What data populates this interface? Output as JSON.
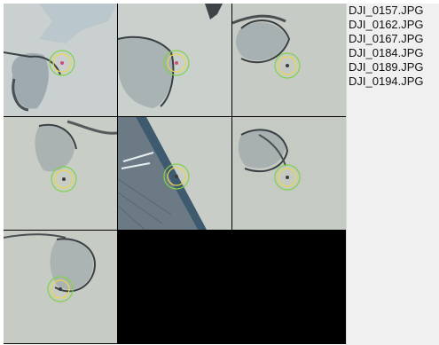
{
  "files": [
    "DJI_0157.JPG",
    "DJI_0162.JPG",
    "DJI_0167.JPG",
    "DJI_0184.JPG",
    "DJI_0189.JPG",
    "DJI_0194.JPG"
  ],
  "thumbnails": [
    {
      "scene": "floe-left",
      "bg": "#b9c6cb"
    },
    {
      "scene": "floe-center",
      "bg": "#c9cfcc"
    },
    {
      "scene": "floe-right",
      "bg": "#c6cac5"
    },
    {
      "scene": "floe-top",
      "bg": "#c7ccc5"
    },
    {
      "scene": "ship-deck",
      "bg": "#c8ccc6"
    },
    {
      "scene": "floe-side",
      "bg": "#c4c9c2"
    },
    {
      "scene": "floe-low",
      "bg": "#c5cac4"
    }
  ],
  "colors": {
    "target_outer": "#7fd24a",
    "target_inner": "#e8d84a",
    "marker": "#3b3b3b",
    "empty_cell": "#000000",
    "ice": "#cfd4cf",
    "floe": "#aeb8b8"
  }
}
